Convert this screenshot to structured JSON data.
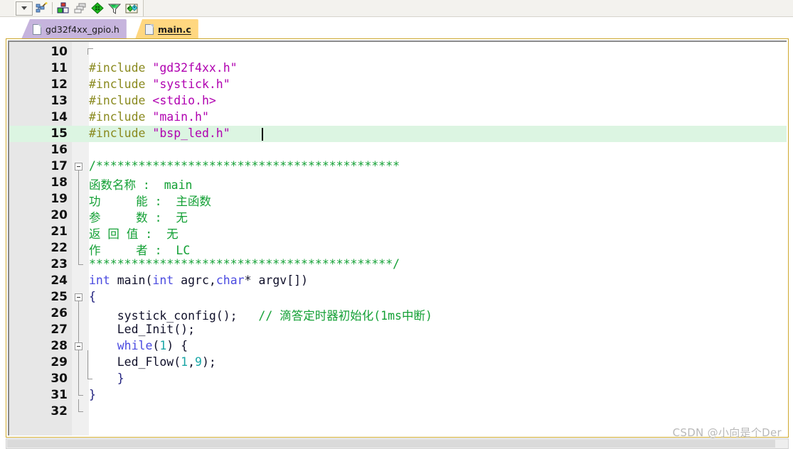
{
  "toolbar": {
    "combo": {
      "name": "dropdown-combo",
      "glyph": "chevron-down"
    },
    "buttons": [
      {
        "name": "configuration-wizard-icon",
        "title": "Configuration Wizard"
      },
      {
        "name": "build-target-icon",
        "title": "Build Target"
      },
      {
        "name": "batch-build-icon",
        "title": "Batch Build"
      },
      {
        "name": "bookmark-diamond-icon",
        "title": "Insert/Remove Bookmark"
      },
      {
        "name": "filter-funnel-icon",
        "title": "Filter"
      },
      {
        "name": "manage-components-icon",
        "title": "Manage Components"
      }
    ]
  },
  "tabs": [
    {
      "label": "gd32f4xx_gpio.h",
      "active": false,
      "color": "#c6b4dd"
    },
    {
      "label": "main.c",
      "active": true,
      "color": "#ffd780"
    }
  ],
  "editor": {
    "first_line": 10,
    "current_line": 15,
    "lines": [
      {
        "n": 10,
        "tokens": []
      },
      {
        "n": 11,
        "tokens": [
          {
            "t": "#include ",
            "c": "pre"
          },
          {
            "t": "\"gd32f4xx.h\"",
            "c": "str"
          }
        ]
      },
      {
        "n": 12,
        "tokens": [
          {
            "t": "#include ",
            "c": "pre"
          },
          {
            "t": "\"systick.h\"",
            "c": "str"
          }
        ]
      },
      {
        "n": 13,
        "tokens": [
          {
            "t": "#include ",
            "c": "pre"
          },
          {
            "t": "<stdio.h>",
            "c": "str"
          }
        ]
      },
      {
        "n": 14,
        "tokens": [
          {
            "t": "#include ",
            "c": "pre"
          },
          {
            "t": "\"main.h\"",
            "c": "str"
          }
        ]
      },
      {
        "n": 15,
        "tokens": [
          {
            "t": "#include ",
            "c": "pre"
          },
          {
            "t": "\"bsp_led.h\"",
            "c": "str"
          }
        ]
      },
      {
        "n": 16,
        "tokens": []
      },
      {
        "n": 17,
        "tokens": [
          {
            "t": "/*******************************************",
            "c": "cmt"
          }
        ]
      },
      {
        "n": 18,
        "tokens": [
          {
            "t": "函数名称 :  main",
            "c": "cmt"
          }
        ]
      },
      {
        "n": 19,
        "tokens": [
          {
            "t": "功     能 :  主函数",
            "c": "cmt"
          }
        ]
      },
      {
        "n": 20,
        "tokens": [
          {
            "t": "参     数 :  无",
            "c": "cmt"
          }
        ]
      },
      {
        "n": 21,
        "tokens": [
          {
            "t": "返 回 值 :  无",
            "c": "cmt"
          }
        ]
      },
      {
        "n": 22,
        "tokens": [
          {
            "t": "作     者 :  LC",
            "c": "cmt"
          }
        ]
      },
      {
        "n": 23,
        "tokens": [
          {
            "t": "*******************************************/",
            "c": "cmt"
          }
        ]
      },
      {
        "n": 24,
        "tokens": [
          {
            "t": "int",
            "c": "kw"
          },
          {
            "t": " main(",
            "c": "plain"
          },
          {
            "t": "int",
            "c": "kw"
          },
          {
            "t": " agrc,",
            "c": "plain"
          },
          {
            "t": "char",
            "c": "kw"
          },
          {
            "t": "* argv[])",
            "c": "plain"
          }
        ]
      },
      {
        "n": 25,
        "tokens": [
          {
            "t": "{",
            "c": "brace"
          }
        ]
      },
      {
        "n": 26,
        "tokens": [
          {
            "t": "    systick_config();",
            "c": "plain"
          },
          {
            "t": "   // 滴答定时器初始化(1ms中断)",
            "c": "cmt"
          }
        ]
      },
      {
        "n": 27,
        "tokens": [
          {
            "t": "    Led_Init();",
            "c": "plain"
          }
        ]
      },
      {
        "n": 28,
        "tokens": [
          {
            "t": "    ",
            "c": "plain"
          },
          {
            "t": "while",
            "c": "kw"
          },
          {
            "t": "(",
            "c": "plain"
          },
          {
            "t": "1",
            "c": "num"
          },
          {
            "t": ") {",
            "c": "plain"
          }
        ]
      },
      {
        "n": 29,
        "tokens": [
          {
            "t": "    Led_Flow(",
            "c": "plain"
          },
          {
            "t": "1",
            "c": "num"
          },
          {
            "t": ",",
            "c": "plain"
          },
          {
            "t": "9",
            "c": "num"
          },
          {
            "t": ");",
            "c": "plain"
          }
        ]
      },
      {
        "n": 30,
        "tokens": [
          {
            "t": "    }",
            "c": "brace"
          }
        ]
      },
      {
        "n": 31,
        "tokens": [
          {
            "t": "}",
            "c": "brace"
          }
        ]
      },
      {
        "n": 32,
        "tokens": []
      }
    ]
  },
  "watermark": {
    "text": "CSDN @小向是个Der"
  },
  "colors": {
    "preprocessor": "#8a8a1f",
    "string": "#b000b0",
    "comment": "#13a035",
    "keyword": "#4a4ae0",
    "number": "#1aa6a6",
    "plain": "#10102a",
    "current_line_highlight": "#dcf5e2",
    "gutter": "#e7e7e7",
    "editor_border": "#cfa92f",
    "active_tab": "#ffd780",
    "inactive_tab": "#c6b4dd"
  }
}
